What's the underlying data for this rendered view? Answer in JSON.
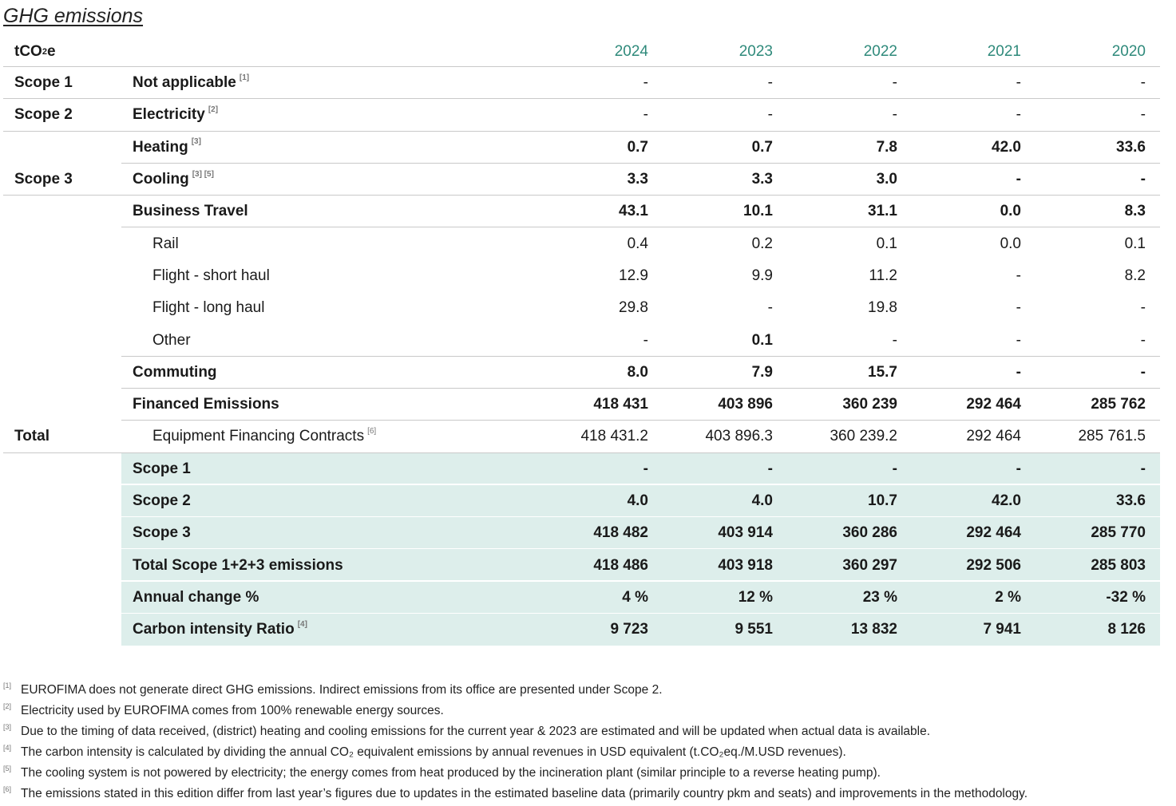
{
  "title": "GHG emissions",
  "unit_label": "tCO",
  "unit_sub": "2",
  "unit_tail": "e",
  "years": [
    "2024",
    "2023",
    "2022",
    "2021",
    "2020"
  ],
  "rows": [
    {
      "group": "Scope 1",
      "label": "Not applicable",
      "sup": "[1]",
      "v": [
        "-",
        "-",
        "-",
        "-",
        "-"
      ]
    },
    {
      "group": "Scope 2",
      "label": "Electricity",
      "sup": "[2]",
      "v": [
        "-",
        "-",
        "-",
        "-",
        "-"
      ]
    },
    {
      "group": "",
      "label": "Heating",
      "sup": "[3]",
      "v": [
        "0.7",
        "0.7",
        "7.8",
        "42.0",
        "33.6"
      ]
    },
    {
      "group": "Scope 3",
      "label": "Cooling",
      "sup": "[3] [5]",
      "v": [
        "3.3",
        "3.3",
        "3.0",
        "-",
        "-"
      ]
    },
    {
      "group": "",
      "label": "Business Travel",
      "sup": "",
      "v": [
        "43.1",
        "10.1",
        "31.1",
        "0.0",
        "8.3"
      ]
    },
    {
      "group": "",
      "label": "Rail",
      "sup": "",
      "v": [
        "0.4",
        "0.2",
        "0.1",
        "0.0",
        "0.1"
      ]
    },
    {
      "group": "",
      "label": "Flight - short haul",
      "sup": "",
      "v": [
        "12.9",
        "9.9",
        "11.2",
        "-",
        "8.2"
      ]
    },
    {
      "group": "",
      "label": "Flight - long haul",
      "sup": "",
      "v": [
        "29.8",
        "-",
        "19.8",
        "-",
        "-"
      ]
    },
    {
      "group": "",
      "label": "Other",
      "sup": "",
      "v": [
        "-",
        "0.1",
        "-",
        "-",
        "-"
      ]
    },
    {
      "group": "",
      "label": "Commuting",
      "sup": "",
      "v": [
        "8.0",
        "7.9",
        "15.7",
        "-",
        "-"
      ]
    },
    {
      "group": "",
      "label": "Financed Emissions",
      "sup": "",
      "v": [
        "418 431",
        "403 896",
        "360 239",
        "292 464",
        "285 762"
      ]
    },
    {
      "group": "Total",
      "label": "Equipment Financing Contracts",
      "sup": "[6]",
      "v": [
        "418 431.2",
        "403 896.3",
        "360 239.2",
        "292 464",
        "285 761.5"
      ]
    }
  ],
  "totals": [
    {
      "label": "Scope 1",
      "sup": "",
      "v": [
        "-",
        "-",
        "-",
        "-",
        "-"
      ]
    },
    {
      "label": "Scope 2",
      "sup": "",
      "v": [
        "4.0",
        "4.0",
        "10.7",
        "42.0",
        "33.6"
      ]
    },
    {
      "label": "Scope 3",
      "sup": "",
      "v": [
        "418 482",
        "403 914",
        "360 286",
        "292 464",
        "285 770"
      ]
    },
    {
      "label": "Total Scope 1+2+3 emissions",
      "sup": "",
      "v": [
        "418 486",
        "403 918",
        "360 297",
        "292 506",
        "285 803"
      ]
    },
    {
      "label": "Annual change %",
      "sup": "",
      "v": [
        "4 %",
        "12 %",
        "23 %",
        "2 %",
        "-32 %"
      ]
    },
    {
      "label": "Carbon intensity Ratio",
      "sup": "[4]",
      "v": [
        "9 723",
        "9 551",
        "13 832",
        "7 941",
        "8 126"
      ]
    }
  ],
  "footnotes": [
    {
      "mark": "[1]",
      "text": "EUROFIMA does not generate direct GHG emissions. Indirect emissions from its office are presented under Scope 2."
    },
    {
      "mark": "[2]",
      "text": "Electricity used by EUROFIMA comes from 100% renewable energy sources."
    },
    {
      "mark": "[3]",
      "text": "Due to the timing of data received, (district) heating and cooling emissions for the current year & 2023 are estimated and will be updated when actual data is available."
    },
    {
      "mark": "[4]",
      "text": "The carbon intensity is calculated by dividing the annual CO₂ equivalent emissions by annual revenues in USD equivalent (t.CO₂eq./M.USD revenues)."
    },
    {
      "mark": "[5]",
      "text": "The cooling system is not powered by electricity; the energy comes from heat produced by the incineration plant (similar principle to a reverse heating pump)."
    },
    {
      "mark": "[6]",
      "text": "The emissions stated in this edition differ from last year’s figures due to updates in the estimated baseline data (primarily country pkm and seats) and improvements in the methodology."
    }
  ]
}
